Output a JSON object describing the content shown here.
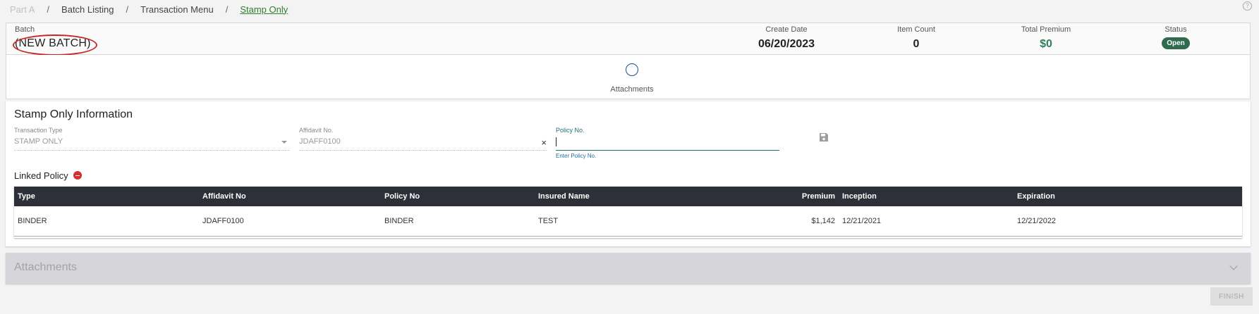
{
  "breadcrumb": {
    "items": [
      "Part A",
      "Batch Listing",
      "Transaction Menu",
      "Stamp Only"
    ],
    "separator": "/"
  },
  "help_icon": "?",
  "batch": {
    "label": "Batch",
    "name": "(NEW BATCH)",
    "create_date_label": "Create Date",
    "create_date": "06/20/2023",
    "item_count_label": "Item Count",
    "item_count": "0",
    "total_premium_label": "Total Premium",
    "total_premium": "$0",
    "status_label": "Status",
    "status": "Open"
  },
  "steps": {
    "attachments_label": "Attachments"
  },
  "stamp_info": {
    "title": "Stamp Only Information",
    "transaction_type_label": "Transaction Type",
    "transaction_type_value": "STAMP ONLY",
    "affidavit_label": "Affidavit No.",
    "affidavit_value": "JDAFF0100",
    "clear_symbol": "×",
    "policy_label": "Policy No.",
    "policy_value": "",
    "policy_hint": "Enter Policy No."
  },
  "linked_policy": {
    "title": "Linked Policy",
    "columns": [
      "Type",
      "Affidavit No",
      "Policy No",
      "Insured Name",
      "Premium",
      "Inception",
      "Expiration"
    ],
    "rows": [
      [
        "BINDER",
        "JDAFF0100",
        "BINDER",
        "TEST",
        "$1,142",
        "12/21/2021",
        "12/21/2022"
      ]
    ]
  },
  "accordion": {
    "title": "Attachments"
  },
  "finish_button": "FINISH",
  "colors": {
    "accent_green": "#2e7d5b",
    "header_dark": "#2d3038",
    "annotation_red": "#c62828",
    "remove_red": "#d32f2f"
  }
}
